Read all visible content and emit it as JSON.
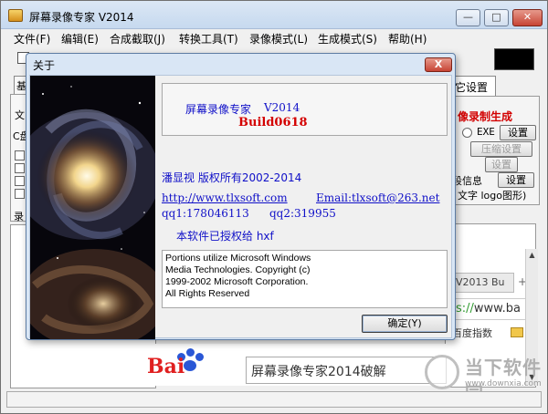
{
  "main": {
    "title": "屏幕录像专家 V2014",
    "menu": [
      "文件(F)",
      "编辑(E)",
      "合成截取(J)",
      "转换工具(T)",
      "录像模式(L)",
      "生成模式(S)",
      "帮助(H)"
    ],
    "left_tab_label": "基",
    "left_texts": [
      "文",
      "C盘",
      "录"
    ],
    "right_tab_label": "它设置",
    "red_label": "像录制生成",
    "exe_label": "EXE",
    "buttons": {
      "set1": "设置",
      "compress": "压缩设置",
      "set2": "设置",
      "set3": "设置"
    },
    "info_label": "段信息",
    "logo_text": "文字 logo图形)"
  },
  "browser": {
    "tab_label": "V2013 Bu",
    "tab_plus": "+",
    "url_scheme": "s://",
    "url_host": "www.ba",
    "favorite": "百度指数",
    "baidu_logo": "Bai",
    "search_text": "屏幕录像专家2014破解"
  },
  "watermark": {
    "text": "当下软件园",
    "url": "www.downxia.com"
  },
  "dialog": {
    "title": "关于",
    "close": "X",
    "app_name": "屏幕录像专家",
    "app_version": "V2014",
    "build": "Build0618",
    "copyright": "潘显视  版权所有2002-2014",
    "website": "http://www.tlxsoft.com",
    "email": "Email:tlxsoft@263.net",
    "qq1": "qq1:178046113",
    "qq2": "qq2:319955",
    "licensed_to": "本软件已授权给  hxf",
    "notice": [
      "Portions utilize Microsoft Windows",
      "Media Technologies.  Copyright (c)",
      "1999-2002 Microsoft Corporation.",
      "All Rights Reserved"
    ],
    "ok_label": "确定(Y)"
  },
  "colors": {
    "link_blue": "#1010c8",
    "build_red": "#d40000",
    "title_gradient_top": "#dbe7f5"
  }
}
